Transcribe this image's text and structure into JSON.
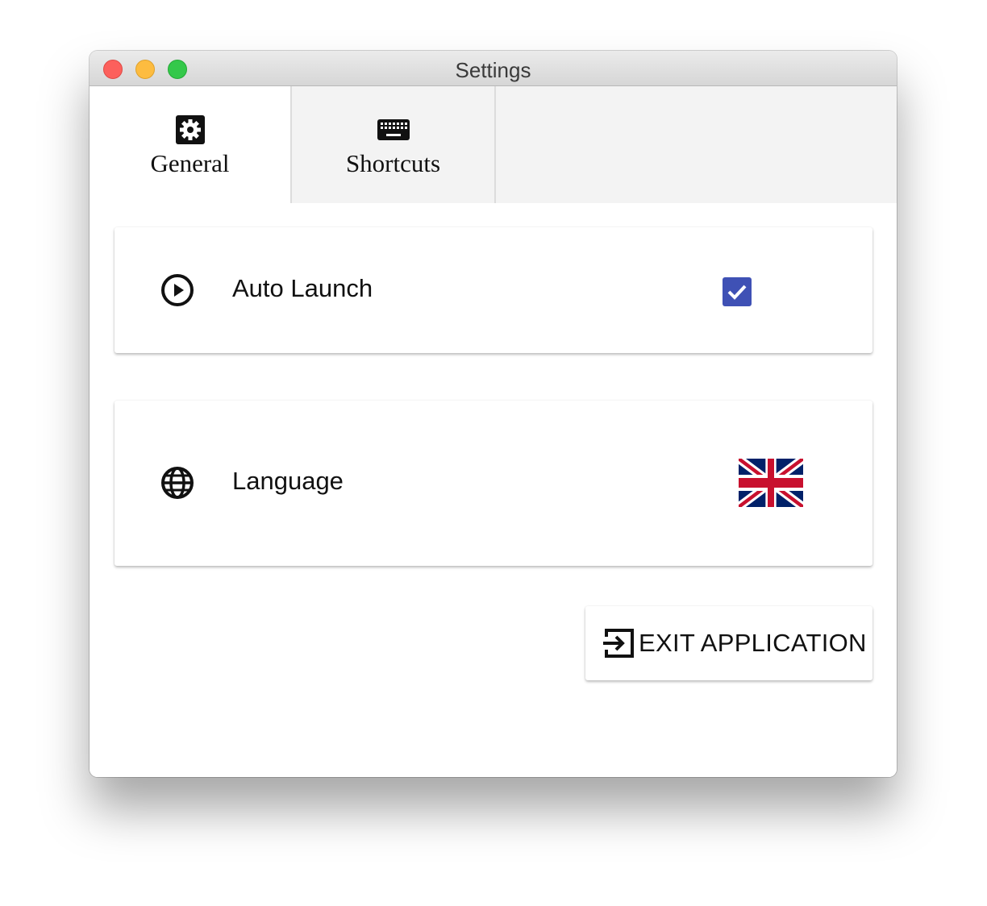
{
  "window": {
    "title": "Settings"
  },
  "tabs": [
    {
      "label": "General",
      "icon": "gear-icon",
      "active": true
    },
    {
      "label": "Shortcuts",
      "icon": "keyboard-icon",
      "active": false
    }
  ],
  "settings": {
    "auto_launch": {
      "label": "Auto Launch",
      "icon": "play-circle-icon",
      "checked": true
    },
    "language": {
      "label": "Language",
      "icon": "globe-icon",
      "flag": "uk-flag-icon"
    }
  },
  "exit_button": {
    "label": "EXIT APPLICATION",
    "icon": "exit-icon"
  },
  "colors": {
    "checkbox": "#3f51b5",
    "close": "#fc605c",
    "minimize": "#fdbc40",
    "maximize": "#34c84a",
    "flag_blue": "#012169",
    "flag_red": "#c8102e"
  }
}
